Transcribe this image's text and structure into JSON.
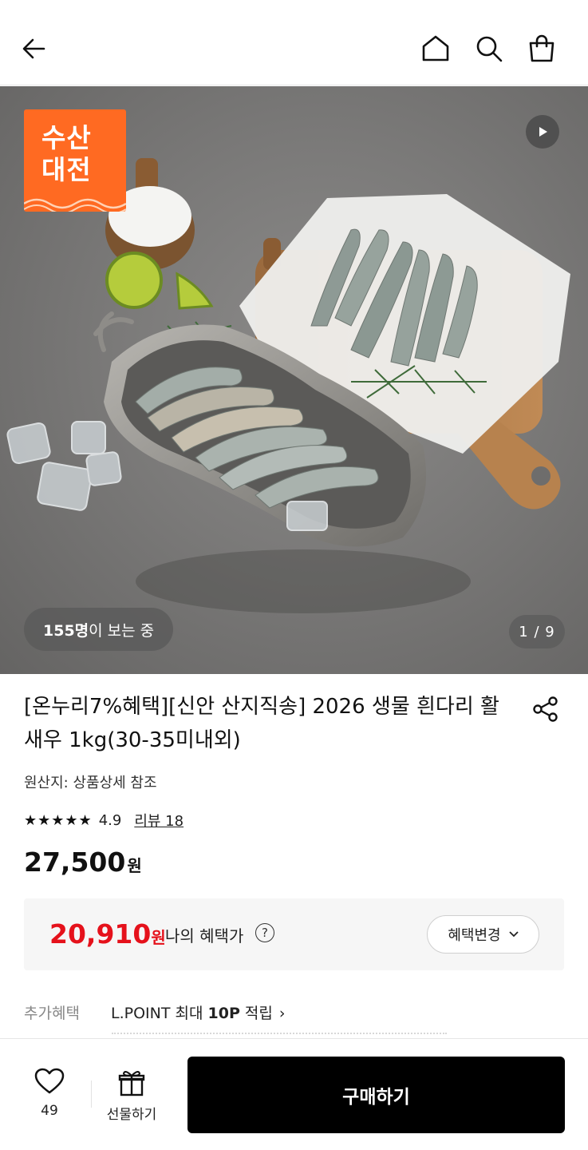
{
  "header": {
    "back_icon": "arrow-left-icon",
    "home_icon": "home-icon",
    "search_icon": "search-icon",
    "cart_icon": "shopping-bag-icon"
  },
  "hero": {
    "badge_line1": "수산",
    "badge_line2": "대전",
    "badge_color": "#ff6a22",
    "play_icon": "play-icon",
    "viewers_count": "155명",
    "viewers_suffix": "이 보는 중",
    "pager": "1 / 9"
  },
  "product": {
    "title": "[온누리7%혜택][신안 산지직송] 2026 생물 흰다리 활새우 1kg(30-35미내외)",
    "share_icon": "share-icon",
    "origin": "원산지: 상품상세 참조",
    "stars": "★★★★★",
    "rating": "4.9",
    "review_link": "리뷰 18",
    "price_number": "27,500",
    "price_unit": "원"
  },
  "benefit": {
    "price_number": "20,910",
    "price_unit": "원",
    "price_color": "#e5111b",
    "label": "나의 혜택가",
    "help_icon": "question-mark-icon",
    "help_glyph": "?",
    "change_label": "혜택변경",
    "change_chevron": "⌄"
  },
  "extra": {
    "label": "추가혜택",
    "value_prefix": "L.POINT 최대 ",
    "value_bold": "10P",
    "value_suffix": " 적립",
    "arrow": "›"
  },
  "bottom_bar": {
    "wish_icon": "heart-icon",
    "wish_count": "49",
    "gift_icon": "gift-icon",
    "gift_label": "선물하기",
    "buy_label": "구매하기"
  }
}
